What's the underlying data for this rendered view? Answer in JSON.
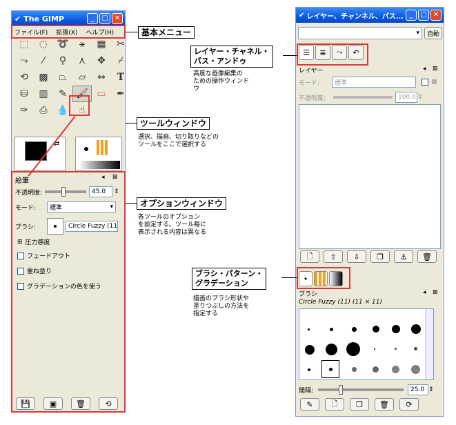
{
  "toolbox": {
    "title": "The GIMP",
    "menu": [
      "ファイル(F)",
      "拡張(X)",
      "ヘルプ(H)"
    ]
  },
  "tools": [
    "rect-select",
    "ellipse-select",
    "lasso",
    "fuzzy-select",
    "color-select",
    "scissors",
    "paths",
    "color-picker",
    "magnify",
    "measure",
    "move",
    "crop",
    "rotate",
    "transform",
    "perspective",
    "flip",
    "text",
    "bucket-fill",
    "blend",
    "pencil",
    "paintbrush",
    "eraser",
    "airbrush",
    "ink",
    "clone",
    "blur",
    "dodge-burn",
    "smudge"
  ],
  "options": {
    "title": "絵筆",
    "opacity_label": "不透明度:",
    "opacity_value": "45.0",
    "opacity_fraction": 0.45,
    "mode_label": "モード:",
    "mode_value": "標準",
    "brush_label": "ブラシ:",
    "brush_value": "Circle Fuzzy (11)",
    "pressure": "圧力感度",
    "fade": "フェードアウト",
    "incremental": "重ね塗り",
    "gradient": "グラデーションの色を使う"
  },
  "layers": {
    "title": "レイヤー、チャンネル、パス...",
    "auto": "自動",
    "section": "レイヤー",
    "mode_label": "モード:",
    "mode_value": "標準",
    "opacity_label": "不透明度:",
    "opacity_value": "100.0"
  },
  "brushes": {
    "section": "ブラシ",
    "brush_name": "Circle Fuzzy (11) (11 × 11)",
    "spacing_label": "間隔:",
    "spacing_value": "25.0",
    "spacing_fraction": 0.25
  },
  "annotations": {
    "menu": "基本メニュー",
    "lcpu": "レイヤー・チャネル・\nパス・アンドゥ",
    "lcpu_note": "高度な画像編集の\nための操作ウィンド\nウ",
    "toolwin": "ツールウィンドウ",
    "toolwin_note": "選択、描画、切り取りなどの\nツールをここで選択する",
    "optwin": "オプションウィンドウ",
    "optwin_note": "各ツールのオプション\nを設定する。ツール毎に\n表示される内容は異なる",
    "bpg": "ブラシ・パターン・\nグラデーション",
    "bpg_note": "描画のブラシ形状や\n塗りつぶしの方法を\n指定する"
  }
}
